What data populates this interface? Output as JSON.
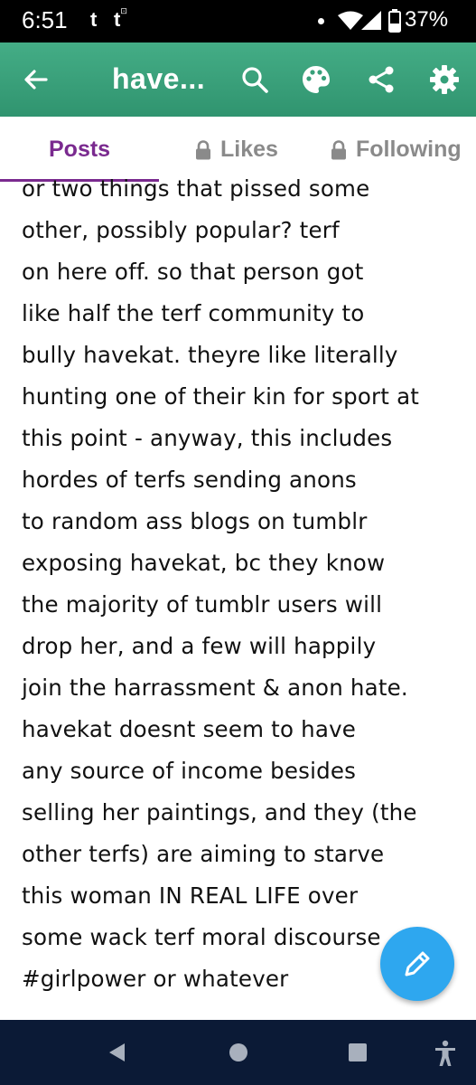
{
  "status_bar": {
    "time": "6:51",
    "app_icons": [
      "t",
      "t"
    ],
    "battery_percent": "37%",
    "icons": [
      "notification-dot-icon",
      "wifi-icon",
      "signal-icon",
      "battery-icon"
    ]
  },
  "app_bar": {
    "title": "have...",
    "background_color": "#3aa07a",
    "icons": [
      "back-arrow-icon",
      "search-icon",
      "palette-icon",
      "share-icon",
      "gear-icon"
    ]
  },
  "tabs": [
    {
      "label": "Posts",
      "active": true,
      "locked": false
    },
    {
      "label": "Likes",
      "active": false,
      "locked": true
    },
    {
      "label": "Following",
      "active": false,
      "locked": true
    }
  ],
  "accent_color": "#7a2a8f",
  "post": {
    "lines": [
      "or two things that pissed some",
      "other, possibly popular? terf",
      "on here off. so that person got",
      "like half the terf community to",
      "bully havekat. theyre like literally",
      "hunting one of their kin for sport at",
      "this point - anyway, this includes",
      "hordes of terfs sending anons",
      "to random ass blogs on tumblr",
      "exposing havekat, bc they know",
      "the majority of tumblr users will",
      "drop her, and a few will happily",
      "join the harrassment & anon hate.",
      "havekat doesnt seem to have",
      "any source of income besides",
      "selling her paintings, and they (the",
      "other terfs) are aiming to starve",
      "this woman IN REAL LIFE over",
      "some wack terf moral discourse",
      "#girlpower or whatever"
    ]
  },
  "fab": {
    "icon": "pencil-icon",
    "color": "#2ea7ef"
  },
  "nav_bar": {
    "icons": [
      "back-triangle-icon",
      "home-circle-icon",
      "recents-square-icon",
      "accessibility-icon"
    ]
  }
}
